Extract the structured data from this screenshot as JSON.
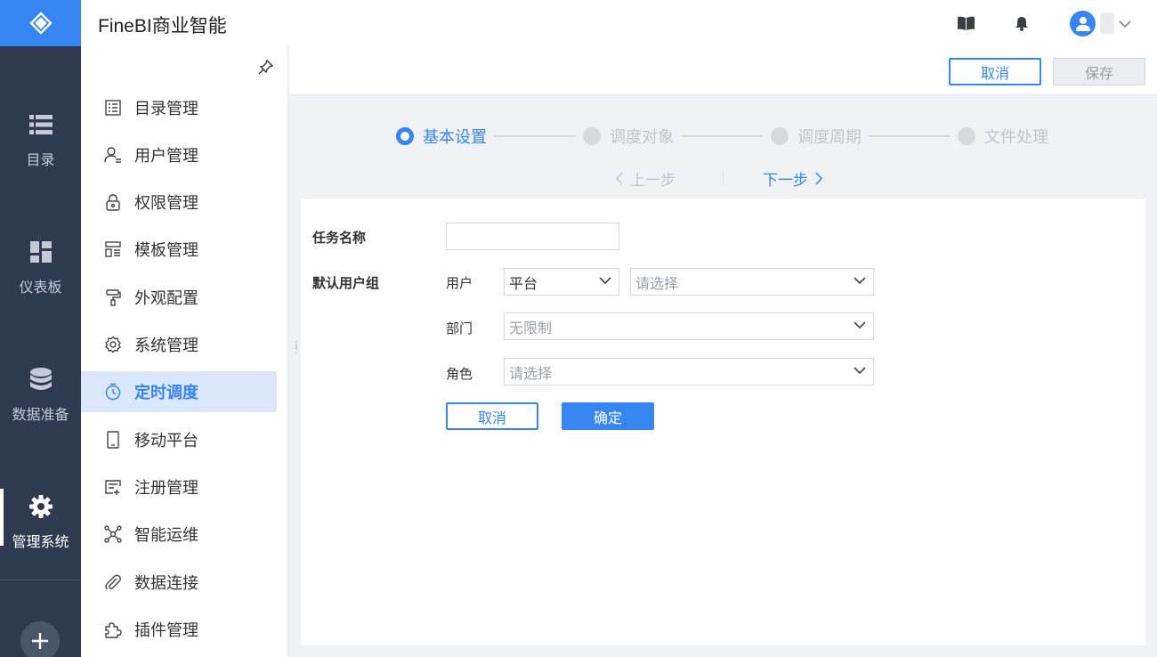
{
  "app": {
    "title": "FineBI商业智能"
  },
  "colors": {
    "rail_bg": "#2d3a4f",
    "brand": "#3685f2",
    "active_menu_bg": "#dbe7fc"
  },
  "rail": {
    "items": [
      {
        "label": "目录",
        "icon": "list-icon"
      },
      {
        "label": "仪表板",
        "icon": "dashboard-icon"
      },
      {
        "label": "数据准备",
        "icon": "database-icon"
      },
      {
        "label": "管理系统",
        "icon": "gear-icon",
        "active": true
      }
    ]
  },
  "sidebar": {
    "items": [
      {
        "label": "目录管理",
        "icon": "catalog-icon"
      },
      {
        "label": "用户管理",
        "icon": "user-icon"
      },
      {
        "label": "权限管理",
        "icon": "lock-icon"
      },
      {
        "label": "模板管理",
        "icon": "template-icon"
      },
      {
        "label": "外观配置",
        "icon": "paint-roller-icon"
      },
      {
        "label": "系统管理",
        "icon": "settings-icon"
      },
      {
        "label": "定时调度",
        "icon": "timer-icon",
        "active": true
      },
      {
        "label": "移动平台",
        "icon": "mobile-icon"
      },
      {
        "label": "注册管理",
        "icon": "register-icon"
      },
      {
        "label": "智能运维",
        "icon": "network-icon"
      },
      {
        "label": "数据连接",
        "icon": "paperclip-icon"
      },
      {
        "label": "插件管理",
        "icon": "puzzle-icon"
      }
    ]
  },
  "toolbar": {
    "cancel_label": "取消",
    "save_label": "保存"
  },
  "steps": {
    "items": [
      {
        "label": "基本设置",
        "active": true
      },
      {
        "label": "调度对象"
      },
      {
        "label": "调度周期"
      },
      {
        "label": "文件处理"
      }
    ],
    "prev_label": "上一步",
    "next_label": "下一步"
  },
  "form": {
    "task_name_label": "任务名称",
    "task_name_value": "",
    "default_group_label": "默认用户组",
    "user_label": "用户",
    "user_type_value": "平台",
    "user_placeholder": "请选择",
    "dept_label": "部门",
    "dept_placeholder": "无限制",
    "role_label": "角色",
    "role_placeholder": "请选择",
    "cancel_label": "取消",
    "confirm_label": "确定"
  }
}
